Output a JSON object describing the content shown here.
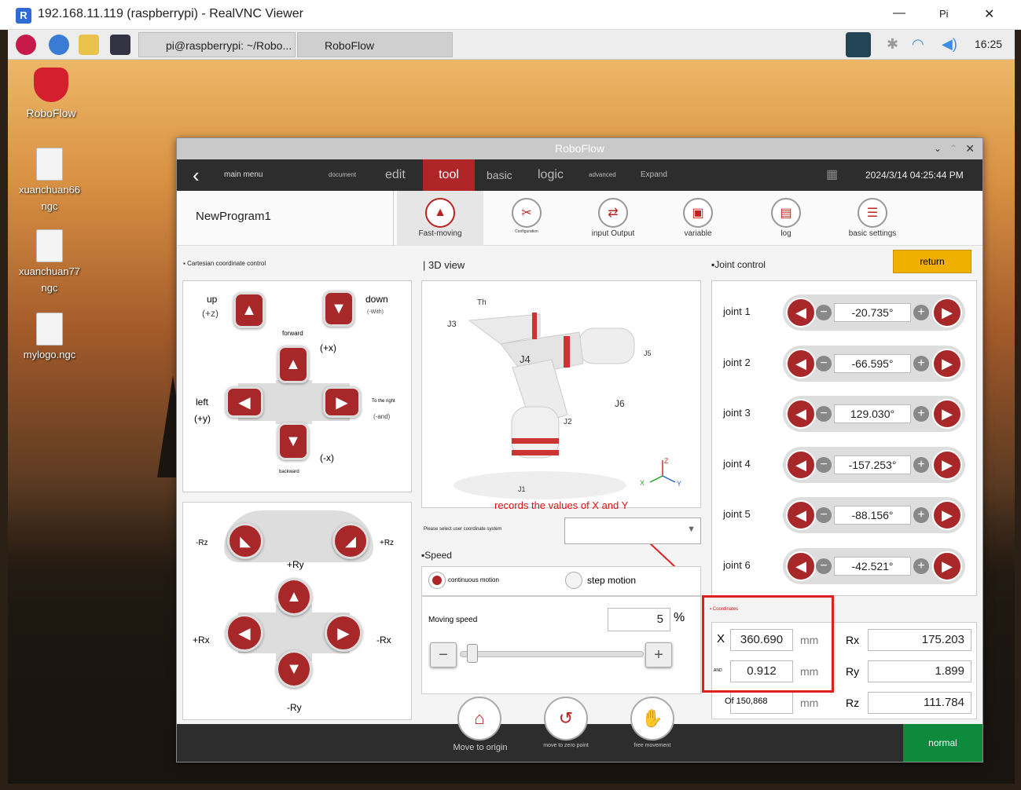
{
  "vnc": {
    "title": "192.168.11.119 (raspberrypi) - RealVNC Viewer",
    "user": "Pi",
    "min": "—",
    "max": "☐",
    "close": "✕"
  },
  "taskbar": {
    "terminal_label": "pi@raspberrypi: ~/Robo...",
    "app_label": "RoboFlow",
    "clock": "16:25"
  },
  "desktop": {
    "icons": [
      {
        "label": "RoboFlow"
      },
      {
        "label": "xuanchuan66",
        "sub": "ngc"
      },
      {
        "label": "xuanchuan77",
        "sub": "ngc"
      },
      {
        "label": "mylogo.ngc"
      }
    ]
  },
  "app": {
    "title": "RoboFlow",
    "menu": {
      "back": "‹",
      "main_menu": "main menu",
      "document": "document",
      "edit": "edit",
      "tool": "tool",
      "basic": "basic",
      "logic": "logic",
      "advanced": "advanced",
      "expand": "Expand",
      "datetime": "2024/3/14 04:25:44 PM"
    },
    "program_name": "NewProgram1",
    "tools": [
      {
        "label": "Fast-moving"
      },
      {
        "label": "Configuration"
      },
      {
        "label": "input Output"
      },
      {
        "label": "variable"
      },
      {
        "label": "log"
      },
      {
        "label": "basic settings"
      }
    ],
    "cartesian": {
      "title": "Cartesian coordinate control",
      "up": "up",
      "up_sub": "(+z)",
      "down": "down",
      "down_sub": "(-With)",
      "forward": "forward",
      "forward_sub": "(+x)",
      "left": "left",
      "left_sub": "(+y)",
      "right": "To the right",
      "right_sub": "(-and)",
      "backward": "backward",
      "backward_sub": "(-x)",
      "rz_minus": "-Rz",
      "rz_plus": "+Rz",
      "ry_plus": "+Ry",
      "rx_plus": "+Rx",
      "rx_minus": "-Rx",
      "ry_minus": "-Ry"
    },
    "view3d": {
      "title": "| 3D view",
      "annotation": "records the values of X and Y",
      "labels": {
        "th": "Th",
        "j3": "J3",
        "j4": "J4",
        "j5": "J5",
        "j6": "J6",
        "j2": "J2",
        "j1": "J1",
        "x": "X",
        "y": "Y",
        "z": "Z"
      }
    },
    "coord_system": {
      "label": "Please select user coordinate system",
      "value": ""
    },
    "speed": {
      "title": "Speed",
      "continuous": "continuous motion",
      "step": "step motion",
      "moving_speed": "Moving speed",
      "value": "5",
      "unit": "%",
      "slider_fraction": 0.04
    },
    "joint_control": {
      "title": "Joint control",
      "return": "return",
      "joints": [
        {
          "name": "joint 1",
          "value": "-20.735°"
        },
        {
          "name": "joint 2",
          "value": "-66.595°"
        },
        {
          "name": "joint 3",
          "value": "129.030°"
        },
        {
          "name": "joint 4",
          "value": "-157.253°"
        },
        {
          "name": "joint 5",
          "value": "-88.156°"
        },
        {
          "name": "joint 6",
          "value": "-42.521°"
        }
      ]
    },
    "coordinates": {
      "title": "Coordinates",
      "x_label": "X",
      "x": "360.690",
      "y_label": "AND",
      "y": "0.912",
      "z_label": "Of 150,868",
      "unit": "mm",
      "rx_label": "Rx",
      "rx": "175.203",
      "ry_label": "Ry",
      "ry": "1.899",
      "rz_label": "Rz",
      "rz": "111.784"
    },
    "bottom": {
      "origin": "Move to origin",
      "zero": "move to zero point",
      "free": "free movement",
      "mode": "normal"
    }
  }
}
